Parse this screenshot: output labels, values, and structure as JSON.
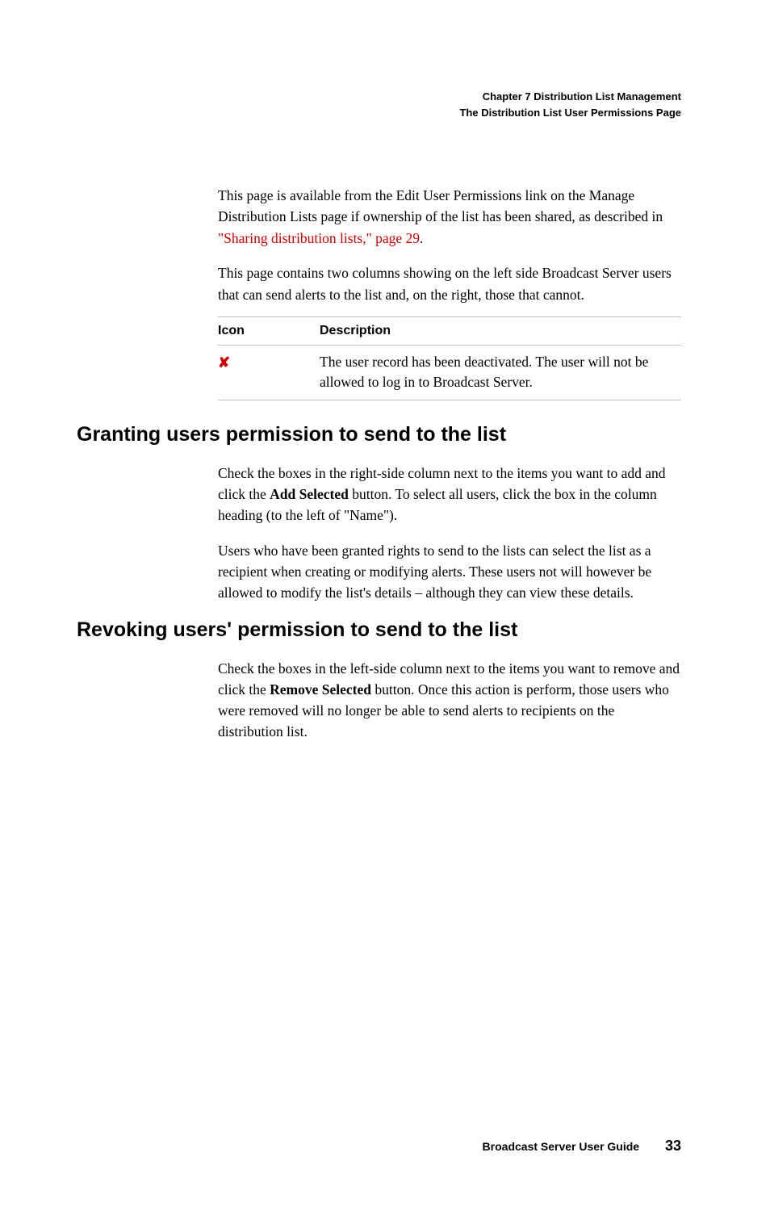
{
  "header": {
    "chapter_line": "Chapter 7     Distribution List Management",
    "subline": "The Distribution List User Permissions Page"
  },
  "intro": {
    "p1_prefix": "This page is available from the Edit User Permissions link on the Manage Distribution Lists page if ownership of the list has been shared, as described in ",
    "p1_link": "\"Sharing distribution lists,\" page 29",
    "p1_suffix": ".",
    "p2": "This page contains two columns showing on the left side Broadcast Server users that can send alerts to the list and, on the right, those that cannot."
  },
  "table": {
    "col_icon": "Icon",
    "col_desc": "Description",
    "row_icon": "✘",
    "row_desc": "The user record has been deactivated. The user will not be allowed to log in to Broadcast Server."
  },
  "section_grant": {
    "heading": "Granting users permission to send to the list",
    "p1_a": "Check the boxes in the right-side column next to the items you want to add and click the ",
    "p1_bold": "Add Selected",
    "p1_b": " button. To select all users, click the box in the column heading (to the left of \"Name\").",
    "p2": "Users who have been granted rights to send to the lists can select the list as a recipient when creating or modifying alerts. These users not will however be allowed to modify the list's details – although they can view these details."
  },
  "section_revoke": {
    "heading": "Revoking users' permission to send to the list",
    "p1_a": "Check the boxes in the left-side column next to the items you want to remove and click the ",
    "p1_bold": "Remove Selected",
    "p1_b": " button. Once this action is perform, those users who were removed will no longer be able to send alerts to recipients on the distribution list."
  },
  "footer": {
    "guide": "Broadcast Server User Guide",
    "page": "33"
  }
}
